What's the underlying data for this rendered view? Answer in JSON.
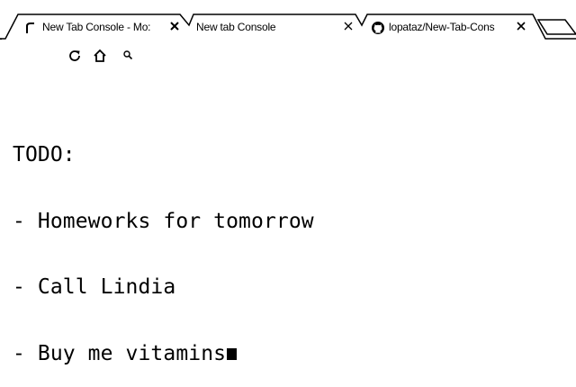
{
  "tabs": [
    {
      "title": "New Tab Console - Mo:",
      "icon": "loading-spinner-icon",
      "active": true
    },
    {
      "title": "New tab Console",
      "icon": "none",
      "active": false
    },
    {
      "title": "lopataz/New-Tab-Cons",
      "icon": "github-icon",
      "active": false
    }
  ],
  "toolbar": {
    "buttons": [
      "reload-icon",
      "home-icon",
      "search-icon"
    ]
  },
  "console": {
    "lines": [
      "TODO:",
      "- Homeworks for tomorrow",
      "- Call Lindia",
      "- Buy me vitamins"
    ]
  }
}
